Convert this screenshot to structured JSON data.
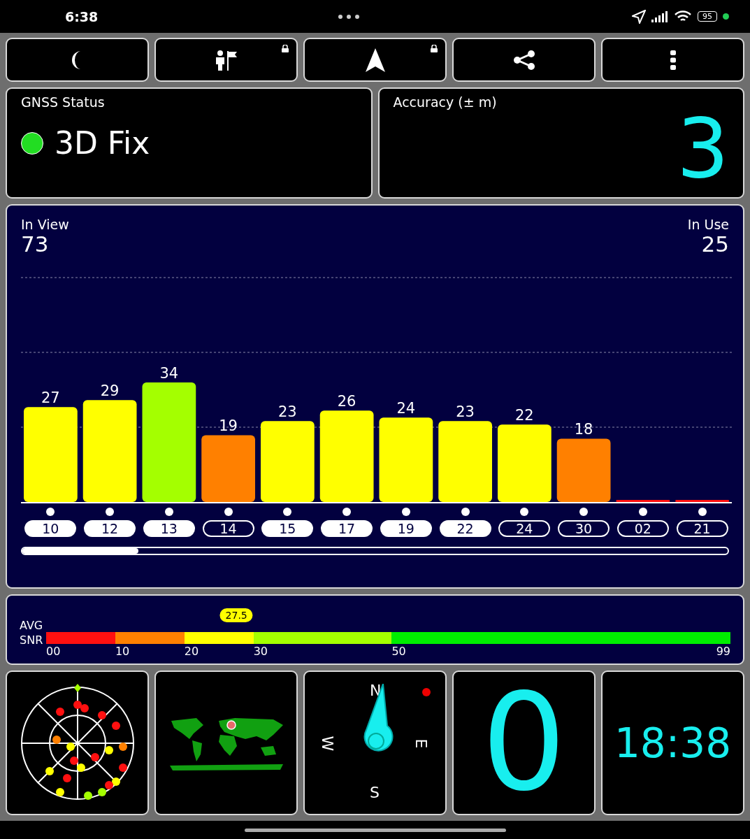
{
  "status_bar": {
    "time": "6:38",
    "battery": "95"
  },
  "toolbar": [
    {
      "kind": "moon",
      "locked": false
    },
    {
      "kind": "flag",
      "locked": true
    },
    {
      "kind": "navigation",
      "locked": true
    },
    {
      "kind": "share",
      "locked": false
    },
    {
      "kind": "more",
      "locked": false
    }
  ],
  "gnss_status": {
    "title": "GNSS Status",
    "value": "3D Fix"
  },
  "accuracy": {
    "title": "Accuracy (± m)",
    "value": "3"
  },
  "satellites": {
    "in_view_label": "In View",
    "in_view": "73",
    "in_use_label": "In Use",
    "in_use": "25",
    "chart_data": {
      "type": "bar",
      "categories": [
        "10",
        "12",
        "13",
        "14",
        "15",
        "17",
        "19",
        "22",
        "24",
        "30",
        "02",
        "21"
      ],
      "values": [
        27,
        29,
        34,
        19,
        23,
        26,
        24,
        23,
        22,
        18,
        0,
        0
      ],
      "value_labels": [
        "27",
        "29",
        "34",
        "19",
        "23",
        "26",
        "24",
        "23",
        "22",
        "18",
        null,
        null
      ]
    },
    "in_use_flags": [
      {
        "selected": true
      },
      {
        "selected": true
      },
      {
        "selected": true
      },
      {
        "selected": false
      },
      {
        "selected": true
      },
      {
        "selected": true
      },
      {
        "selected": true
      },
      {
        "selected": true
      },
      {
        "selected": false
      },
      {
        "selected": false
      },
      {
        "selected": false
      },
      {
        "selected": false
      }
    ]
  },
  "avg_snr": {
    "label_top": "AVG",
    "label_bottom": "SNR",
    "level": 0.278,
    "reading": "27.5",
    "ticks": [
      "00",
      "10",
      "20",
      "30",
      "50",
      "99"
    ]
  },
  "tiles": [
    {
      "kind": "skyplot"
    },
    {
      "kind": "map"
    },
    {
      "kind": "compass",
      "north": "N",
      "east": "E",
      "south": "S",
      "west": "W"
    },
    {
      "kind": "number",
      "value": "0"
    },
    {
      "kind": "clock",
      "value": "18:38"
    }
  ]
}
